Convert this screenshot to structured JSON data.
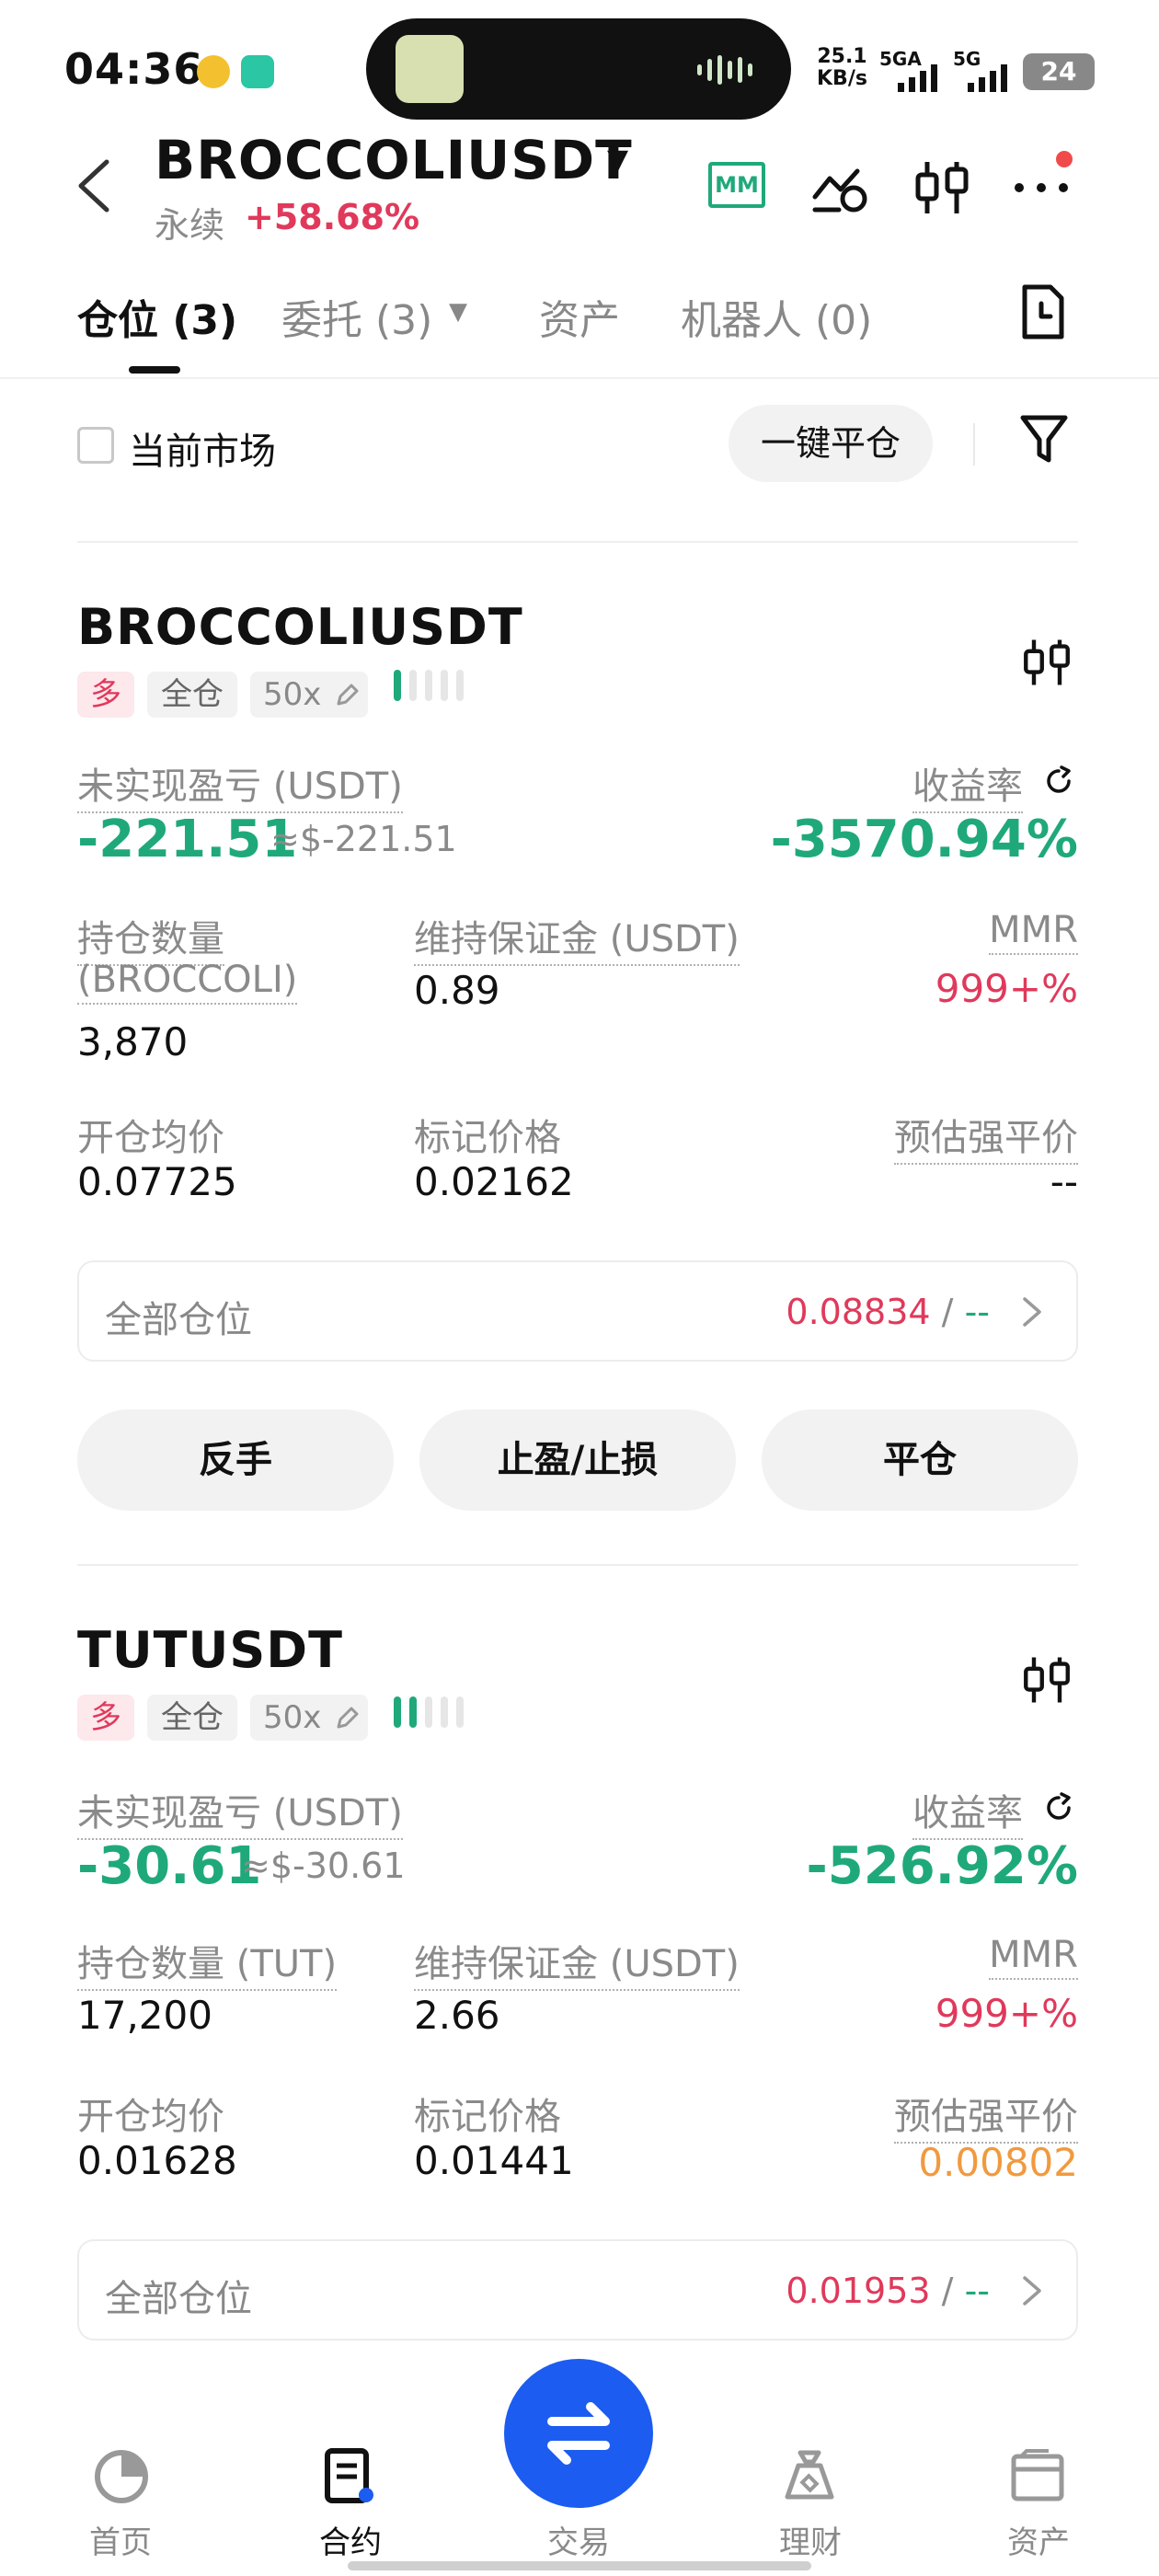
{
  "status": {
    "time": "04:36",
    "speed_value": "25.1",
    "speed_unit": "KB/s",
    "signal1": "5GA",
    "signal2": "5G",
    "battery": "24"
  },
  "header": {
    "pair": "BROCCOLIUSDT",
    "type": "永续",
    "change": "+58.68%",
    "mm_label": "MM"
  },
  "tabs": [
    {
      "label": "仓位 (3)"
    },
    {
      "label": "委托 (3)"
    },
    {
      "label": "资产"
    },
    {
      "label": "机器人 (0)"
    }
  ],
  "filter": {
    "current_market": "当前市场",
    "close_all": "一键平仓"
  },
  "positions": [
    {
      "symbol": "BROCCOLIUSDT",
      "side": "多",
      "margin_mode": "全仓",
      "leverage": "50x",
      "unrealized_label": "未实现盈亏 (USDT)",
      "unrealized": "-221.51",
      "unrealized_usd": "≈$-221.51",
      "roi_label": "收益率",
      "roi": "-3570.94%",
      "qty_label": "持仓数量",
      "qty_label2": "(BROCCOLI)",
      "qty": "3,870",
      "maint_label": "维持保证金 (USDT)",
      "maint": "0.89",
      "mmr_label": "MMR",
      "mmr": "999+%",
      "entry_label": "开仓均价",
      "entry": "0.07725",
      "mark_label": "标记价格",
      "mark": "0.02162",
      "liq_label": "预估强平价",
      "liq": "--",
      "all_pos_label": "全部仓位",
      "all_pos_price": "0.08834",
      "all_pos_sep": "/",
      "all_pos_other": "--",
      "risk_bars_on": 1
    },
    {
      "symbol": "TUTUSDT",
      "side": "多",
      "margin_mode": "全仓",
      "leverage": "50x",
      "unrealized_label": "未实现盈亏 (USDT)",
      "unrealized": "-30.61",
      "unrealized_usd": "≈$-30.61",
      "roi_label": "收益率",
      "roi": "-526.92%",
      "qty_label": "持仓数量 (TUT)",
      "qty": "17,200",
      "maint_label": "维持保证金 (USDT)",
      "maint": "2.66",
      "mmr_label": "MMR",
      "mmr": "999+%",
      "entry_label": "开仓均价",
      "entry": "0.01628",
      "mark_label": "标记价格",
      "mark": "0.01441",
      "liq_label": "预估强平价",
      "liq": "0.00802",
      "all_pos_label": "全部仓位",
      "all_pos_price": "0.01953",
      "all_pos_sep": "/",
      "all_pos_other": "--",
      "risk_bars_on": 2
    }
  ],
  "actions": {
    "reverse": "反手",
    "tpsl": "止盈/止损",
    "close": "平仓"
  },
  "nav": [
    {
      "label": "首页"
    },
    {
      "label": "合约"
    },
    {
      "label": "交易"
    },
    {
      "label": "理财"
    },
    {
      "label": "资产"
    }
  ],
  "colors": {
    "profit_green": "#1fa97a",
    "loss_red": "#e0395b",
    "warning_orange": "#f09a3e",
    "fab_blue": "#1c5cf0"
  }
}
